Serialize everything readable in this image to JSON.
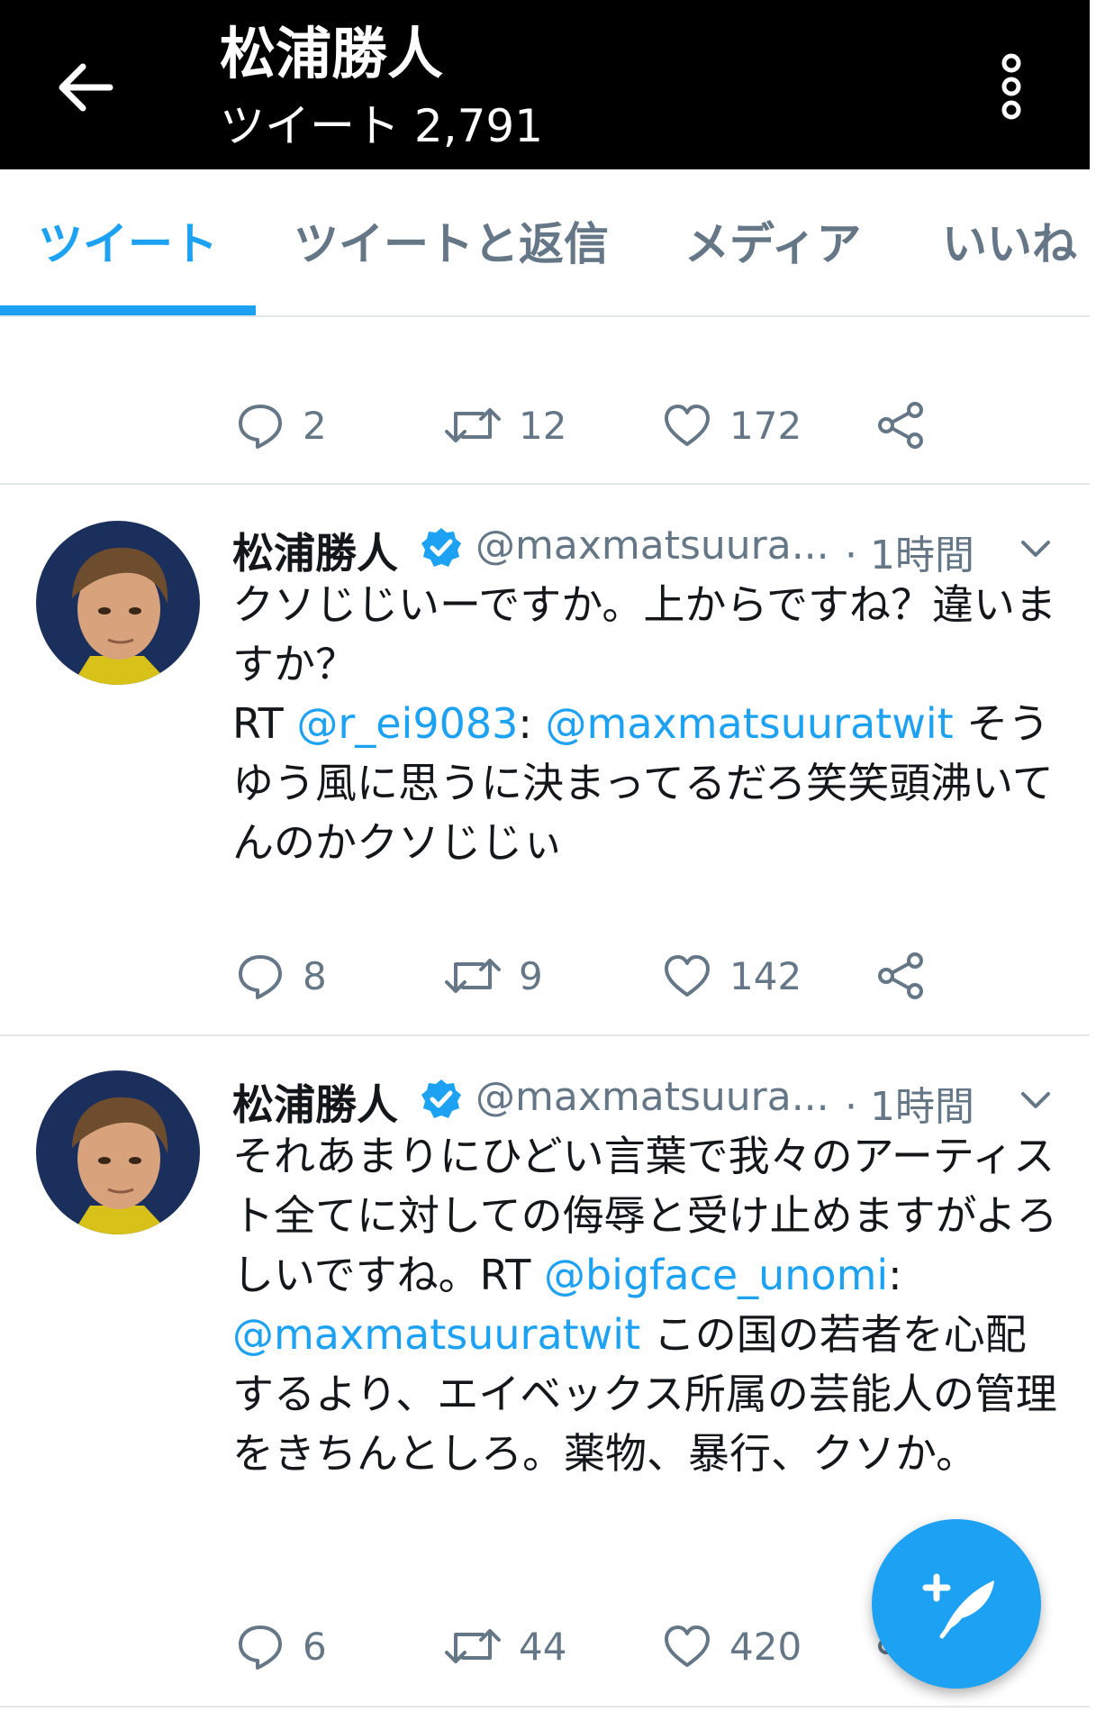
{
  "header": {
    "title": "松浦勝人",
    "tweet_count": "ツイート 2,791"
  },
  "tabs": [
    {
      "label": "ツイート",
      "active": true
    },
    {
      "label": "ツイートと返信",
      "active": false
    },
    {
      "label": "メディア",
      "active": false
    },
    {
      "label": "いいね",
      "active": false
    }
  ],
  "top_actions": {
    "replies": "2",
    "retweets": "12",
    "likes": "172"
  },
  "tweets": [
    {
      "name": "松浦勝人",
      "handle": "@maxmatsuura...",
      "time": "· 1時間",
      "text_1": "クソじじいーですか。上からですね？違いますか？",
      "text_2": "RT ",
      "mention_1": "@r_ei9083",
      "text_3": ": ",
      "mention_2": "@maxmatsuuratwit",
      "text_4": " そうゆう風に思うに決まってるだろ笑笑頭沸いてんのかクソじじぃ",
      "replies": "8",
      "retweets": "9",
      "likes": "142"
    },
    {
      "name": "松浦勝人",
      "handle": "@maxmatsuura...",
      "time": "· 1時間",
      "text_1": "それあまりにひどい言葉で我々のアーティスト全てに対しての侮辱と受け止めますがよろしいですね。RT ",
      "mention_1": "@bigface_unomi",
      "text_2": ": ",
      "mention_2": "@maxmatsuuratwit",
      "text_3": " この国の若者を心配するより、エイベックス所属の芸能人の管理をきちんとしろ。薬物、暴行、クソか。",
      "replies": "6",
      "retweets": "44",
      "likes": "420"
    }
  ],
  "colors": {
    "accent": "#1da1f2",
    "muted": "#657786",
    "header_bg": "#000000"
  },
  "icons": [
    "back-arrow-icon",
    "more-vert-icon",
    "reply-icon",
    "retweet-icon",
    "like-icon",
    "share-icon",
    "verified-icon",
    "caret-down-icon",
    "compose-icon"
  ]
}
